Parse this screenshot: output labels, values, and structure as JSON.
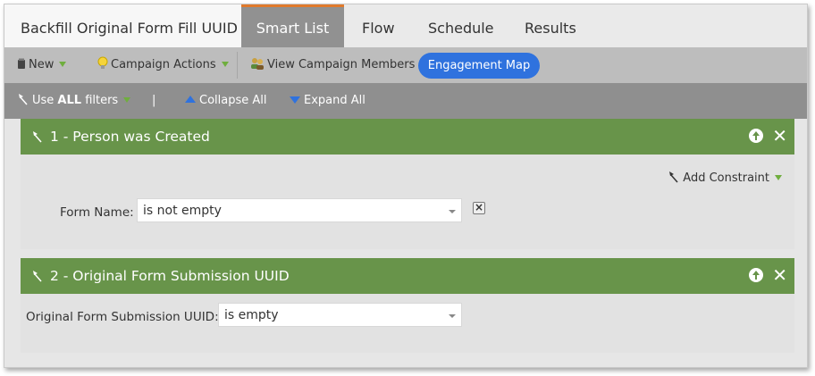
{
  "tabs": {
    "title": "Backfill Original Form Fill UUID",
    "items": [
      {
        "label": "Smart List",
        "active": true
      },
      {
        "label": "Flow",
        "active": false
      },
      {
        "label": "Schedule",
        "active": false
      },
      {
        "label": "Results",
        "active": false
      }
    ]
  },
  "toolbar": {
    "new_label": "New",
    "campaign_actions_label": "Campaign Actions",
    "view_members_label": "View Campaign Members",
    "engagement_map_label": "Engagement Map"
  },
  "filterbar": {
    "use_prefix": "Use ",
    "use_bold": "ALL",
    "use_suffix": " filters",
    "separator": "|",
    "collapse_all": "Collapse All",
    "expand_all": "Expand All"
  },
  "filters": [
    {
      "title": "1 - Person was Created",
      "add_constraint": "Add Constraint",
      "constraint_label": "Form Name:",
      "constraint_value": "is not empty"
    },
    {
      "title": "2 - Original Form Submission UUID",
      "constraint_label": "Original Form Submission UUID:",
      "constraint_value": "is empty"
    }
  ],
  "colors": {
    "accent_tab": "#e07a2c",
    "filter_header": "#68944a",
    "button_blue": "#2f72de"
  },
  "icons": [
    "new-doc-icon",
    "lightbulb-icon",
    "members-icon",
    "filter-wand-icon",
    "collapse-triangle-icon",
    "expand-triangle-icon",
    "move-up-icon",
    "close-icon",
    "remove-constraint-icon",
    "dropdown-caret-icon"
  ]
}
